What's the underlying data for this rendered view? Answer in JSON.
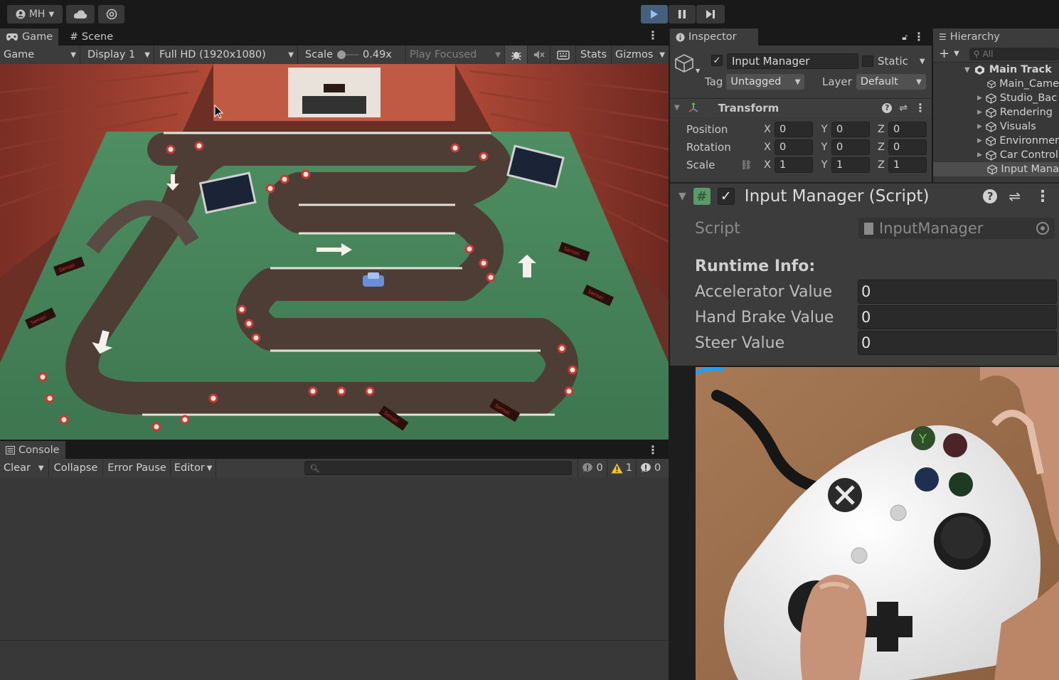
{
  "toolbar": {
    "account_label": "MH",
    "account_icon": "account-icon",
    "cloud_icon": "cloud-icon",
    "collab_icon": "collab-icon",
    "play_icon": "play-icon",
    "pause_icon": "pause-icon",
    "step_icon": "step-icon",
    "play_color": "#46607c"
  },
  "game": {
    "tab_game": "Game",
    "tab_scene": "Scene",
    "view_dropdown": "Game",
    "display_dropdown": "Display 1",
    "resolution_dropdown": "Full HD (1920x1080)",
    "scale_label": "Scale",
    "scale_value": "0.49x",
    "play_focused": "Play Focused",
    "stats_label": "Stats",
    "gizmos_label": "Gizmos",
    "signs": [
      "Sensei",
      "Sensei",
      "Sensei",
      "Sensei",
      "Sensei",
      "Sensei"
    ]
  },
  "console": {
    "tab_label": "Console",
    "clear_label": "Clear",
    "collapse_label": "Collapse",
    "error_pause_label": "Error Pause",
    "editor_label": "Editor",
    "info_count": "0",
    "warning_count": "1",
    "error_count": "0"
  },
  "inspector": {
    "tab_label": "Inspector",
    "object_name": "Input Manager",
    "static_label": "Static",
    "tag_label": "Tag",
    "tag_value": "Untagged",
    "layer_label": "Layer",
    "layer_value": "Default",
    "transform_title": "Transform",
    "position_label": "Position",
    "rotation_label": "Rotation",
    "scale_label": "Scale",
    "axis_x": "X",
    "axis_y": "Y",
    "axis_z": "Z",
    "position": {
      "x": "0",
      "y": "0",
      "z": "0"
    },
    "rotation": {
      "x": "0",
      "y": "0",
      "z": "0"
    },
    "scale": {
      "x": "1",
      "y": "1",
      "z": "1"
    }
  },
  "hierarchy": {
    "tab_label": "Hierarchy",
    "search_placeholder": "All",
    "root": "Main Track",
    "items": [
      "Main_Came",
      "Studio_Bac",
      "Rendering",
      "Visuals",
      "Environmer",
      "Car Control",
      "Input Mana"
    ]
  },
  "script_component": {
    "title": "Input Manager (Script)",
    "script_label": "Script",
    "script_value": "InputManager",
    "runtime_header": "Runtime Info:",
    "accelerator_label": "Accelerator Value",
    "accelerator_value": "0",
    "hand_brake_label": "Hand Brake Value",
    "hand_brake_value": "0",
    "steer_label": "Steer Value",
    "steer_value": "0"
  },
  "webcam": {
    "controller_icon": "gamepad-icon"
  }
}
